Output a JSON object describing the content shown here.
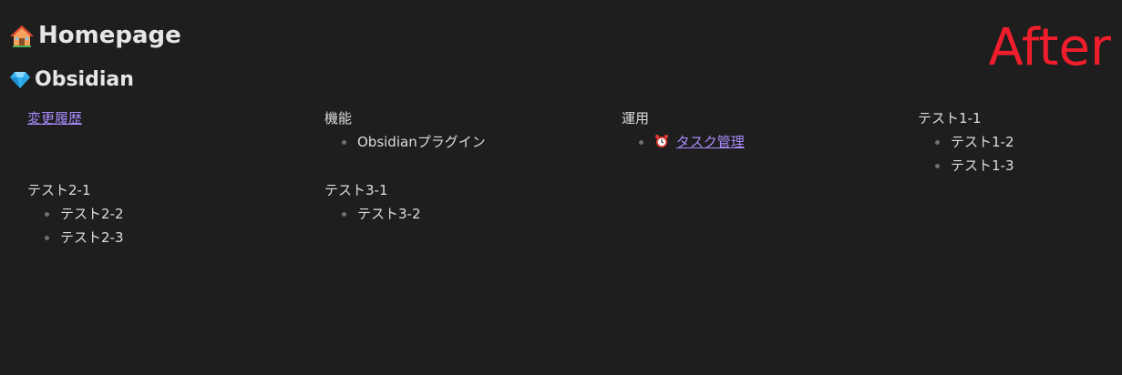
{
  "title_h1": "Homepage",
  "title_h2": "Obsidian",
  "watermark": "After",
  "colors": {
    "background": "#1e1e1e",
    "text": "#dcddde",
    "link": "#a88bfa",
    "watermark": "#f01e2c"
  },
  "icons": {
    "h1": "house-icon",
    "h2": "gem-icon",
    "task": "alarm-clock-icon"
  },
  "grid": {
    "cell_1_1": {
      "link": "変更履歴"
    },
    "cell_1_2": {
      "heading": "機能",
      "items": [
        "Obsidianプラグイン"
      ]
    },
    "cell_1_3": {
      "heading": "運用",
      "items": [
        "タスク管理"
      ]
    },
    "cell_1_4": {
      "heading": "テスト1-1",
      "items": [
        "テスト1-2",
        "テスト1-3"
      ]
    },
    "cell_2_1": {
      "heading": "テスト2-1",
      "items": [
        "テスト2-2",
        "テスト2-3"
      ]
    },
    "cell_2_2": {
      "heading": "テスト3-1",
      "items": [
        "テスト3-2"
      ]
    }
  }
}
